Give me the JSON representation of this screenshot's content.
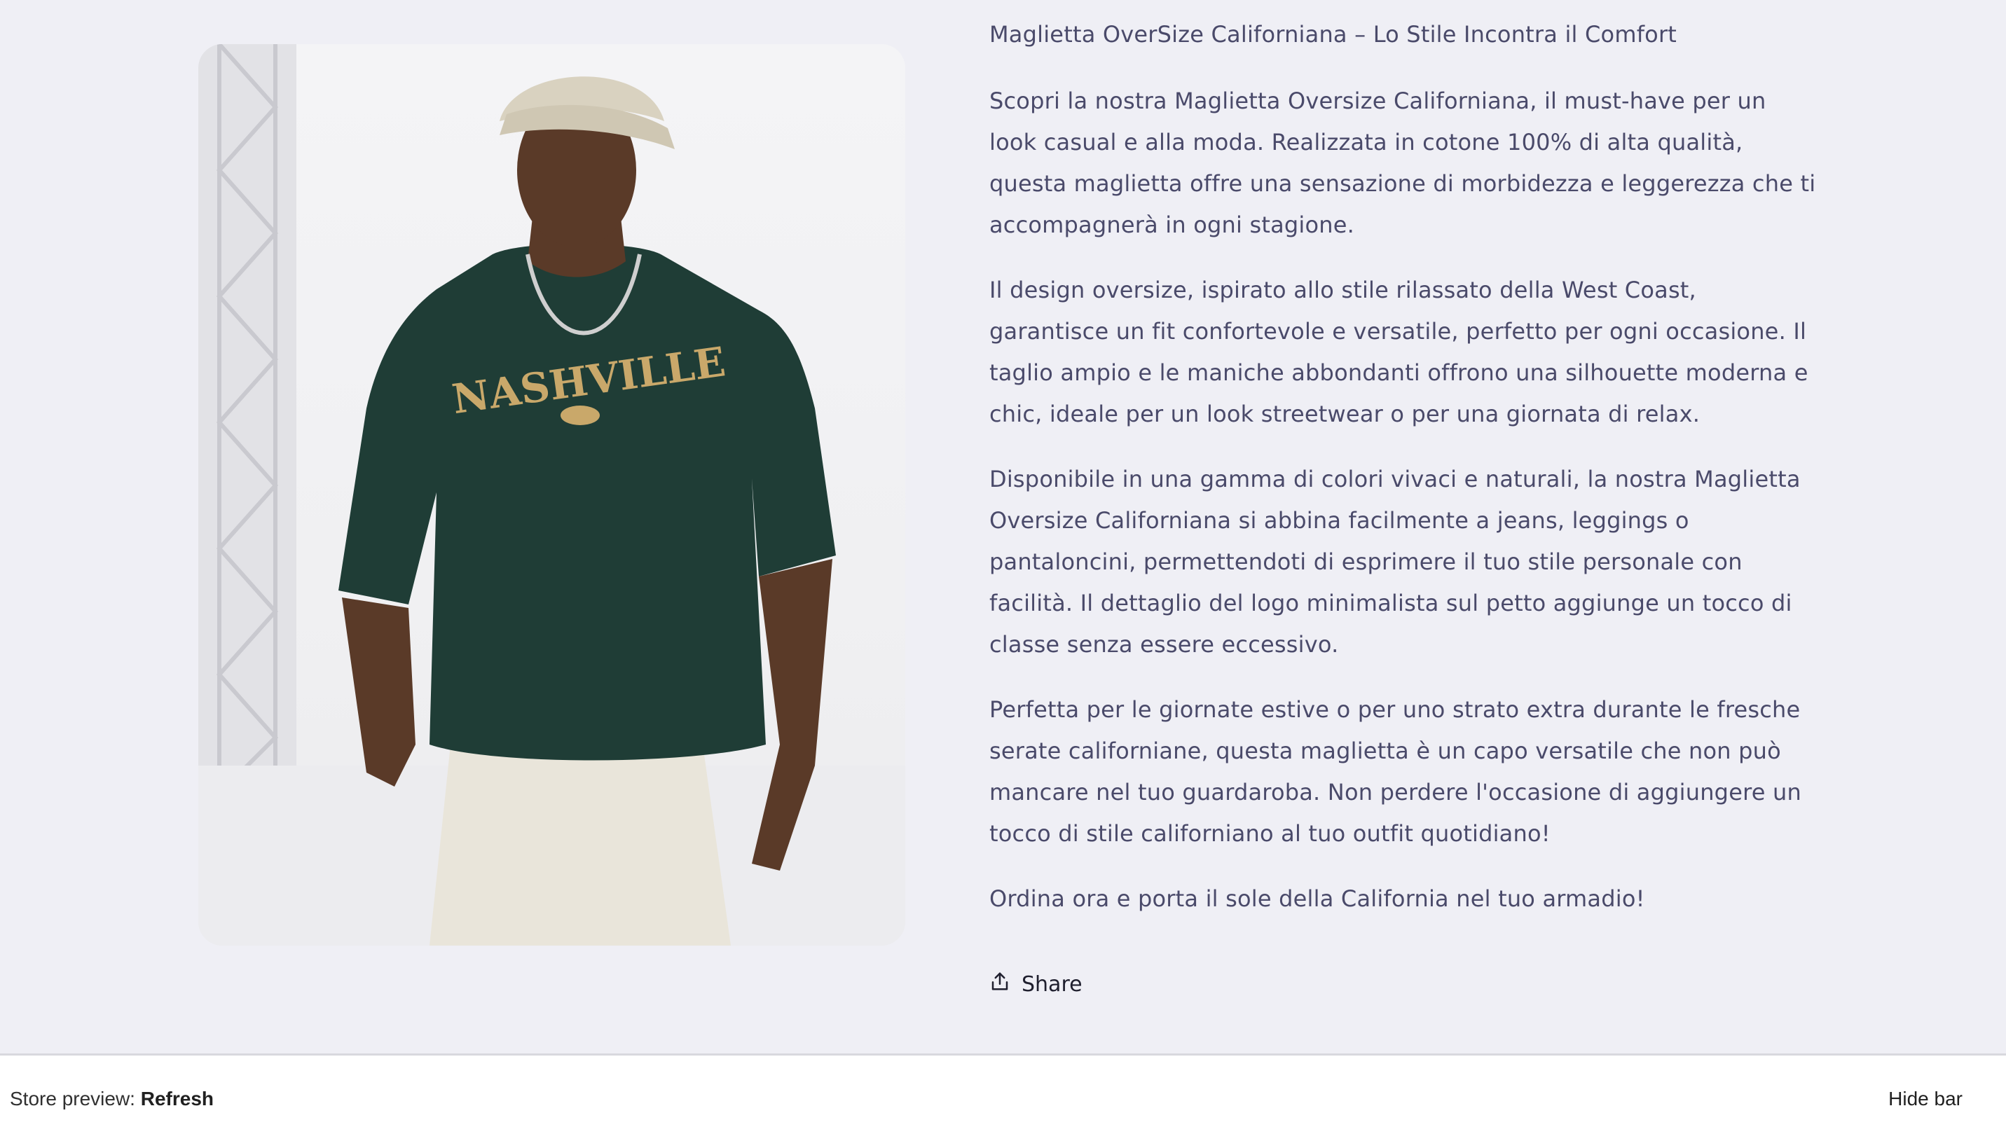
{
  "product": {
    "image_alt": "Man wearing a dark green oversized Nashville t-shirt",
    "title": "Maglietta OverSize Californiana – Lo Stile Incontra il Comfort",
    "paragraphs": [
      "Scopri la nostra Maglietta Oversize Californiana, il must-have per un look casual e alla moda. Realizzata in cotone 100% di alta qualità, questa maglietta offre una sensazione di morbidezza e leggerezza che ti accompagnerà in ogni stagione.",
      "Il design oversize, ispirato allo stile rilassato della West Coast, garantisce un fit confortevole e versatile, perfetto per ogni occasione. Il taglio ampio e le maniche abbondanti offrono una silhouette moderna e chic, ideale per un look streetwear o per una giornata di relax.",
      "Disponibile in una gamma di colori vivaci e naturali, la nostra Maglietta Oversize Californiana si abbina facilmente a jeans, leggings o pantaloncini, permettendoti di esprimere il tuo stile personale con facilità. Il dettaglio del logo minimalista sul petto aggiunge un tocco di classe senza essere eccessivo.",
      "Perfetta per le giornate estive o per uno strato extra durante le fresche serate californiane, questa maglietta è un capo versatile che non può mancare nel tuo guardaroba. Non perdere l'occasione di aggiungere un tocco di stile californiano al tuo outfit quotidiano!",
      "Ordina ora e porta il sole della California nel tuo armadio!"
    ],
    "shirt_print": "NASHVILLE",
    "share_label": "Share",
    "share_icon": "share-icon"
  },
  "preview_bar": {
    "label": "Store preview:",
    "refresh_label": "Refresh",
    "hide_label": "Hide bar"
  },
  "colors": {
    "background": "#efeff5",
    "text": "#4a4a6a",
    "shirt": "#1f3d36"
  }
}
